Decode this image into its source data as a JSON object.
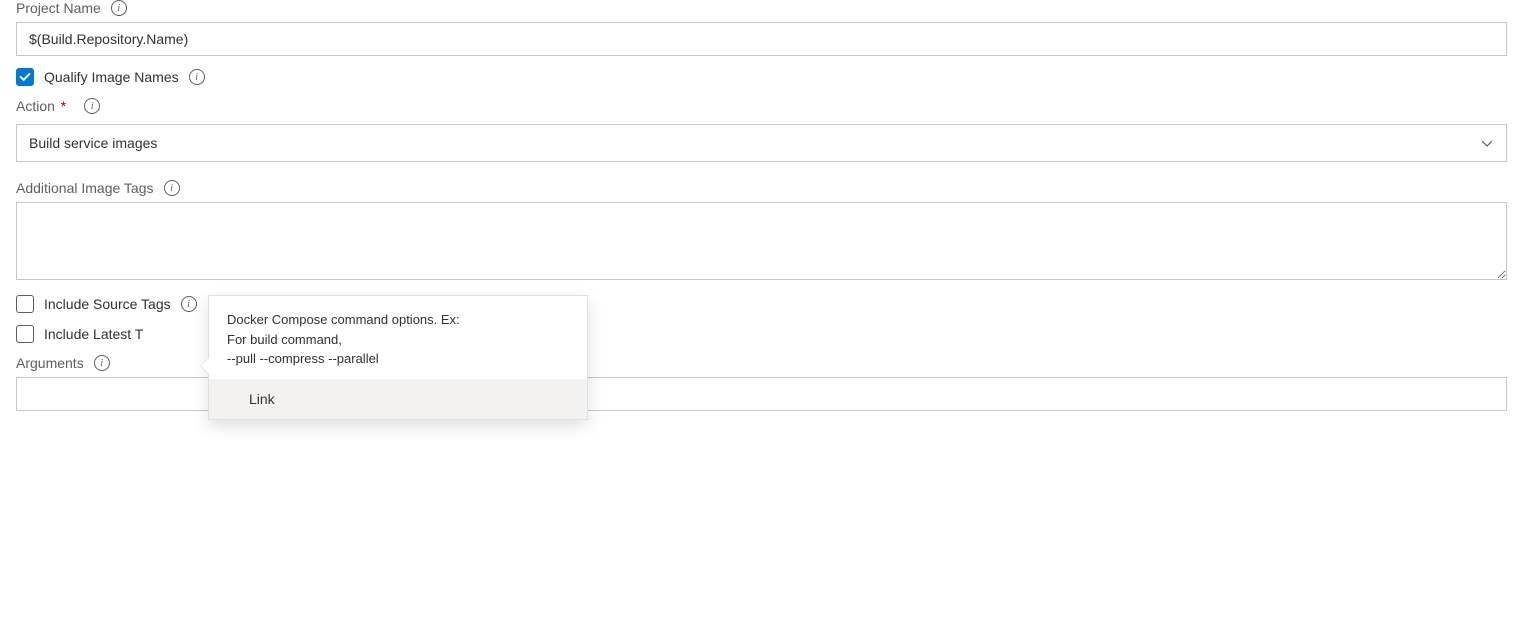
{
  "projectName": {
    "label": "Project Name",
    "value": "$(Build.Repository.Name)"
  },
  "qualifyImageNames": {
    "label": "Qualify Image Names",
    "checked": true
  },
  "action": {
    "label": "Action",
    "selected": "Build service images"
  },
  "additionalImageTags": {
    "label": "Additional Image Tags",
    "value": ""
  },
  "includeSourceTags": {
    "label": "Include Source Tags",
    "checked": false
  },
  "includeLatestTag": {
    "label": "Include Latest T",
    "checked": false
  },
  "arguments": {
    "label": "Arguments",
    "value": ""
  },
  "tooltip": {
    "line1": "Docker Compose command options. Ex:",
    "line2": "For build command,",
    "line3": "--pull --compress --parallel",
    "link": "Link"
  }
}
